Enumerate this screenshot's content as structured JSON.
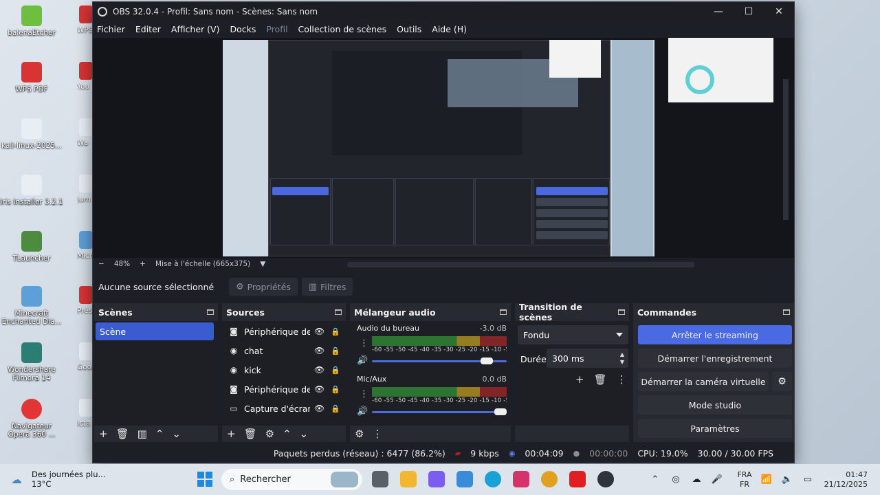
{
  "desktop": {
    "icons": [
      {
        "label": "balenaEtcher",
        "color": "#6fbf3f"
      },
      {
        "label": "WPS PDF",
        "color": "#d93333"
      },
      {
        "label": "kali-linux-2025...",
        "color": "#e8eef3"
      },
      {
        "label": "Iris Installer 3.2.1",
        "color": "#e8eef3"
      },
      {
        "label": "TLauncher",
        "color": "#4d8b3e"
      },
      {
        "label": "Minecraft Enchanted Dia...",
        "color": "#5da0d8"
      },
      {
        "label": "Wondershare Filmora 14",
        "color": "#2a7e73"
      },
      {
        "label": "Navigateur Opera 360 ...",
        "color": "#e23535"
      }
    ],
    "edge_icons": [
      "WPS",
      "You",
      "Wa",
      "jum",
      "Micro",
      "Prés",
      "Googl",
      "Icta"
    ]
  },
  "window": {
    "title": "OBS 32.0.4 - Profil: Sans nom - Scènes: Sans nom",
    "controls": {
      "minimize": "—",
      "maximize": "☐",
      "close": "✕"
    }
  },
  "menu": [
    "Fichier",
    "Editer",
    "Afficher (V)",
    "Docks",
    "Profil",
    "Collection de scènes",
    "Outils",
    "Aide (H)"
  ],
  "zoom": {
    "minus": "−",
    "value": "48%",
    "plus": "+",
    "scale": "Mise à l'échelle (665x375)",
    "caret": "▼"
  },
  "context": {
    "no_source": "Aucune source sélectionné",
    "properties": "Propriétés",
    "filters": "Filtres"
  },
  "scenes": {
    "title": "Scènes",
    "items": [
      "Scène"
    ]
  },
  "sources": {
    "title": "Sources",
    "items": [
      {
        "name": "Périphérique de capture",
        "icon": "camera-icon",
        "glyph": "◙"
      },
      {
        "name": "chat",
        "icon": "globe-icon",
        "glyph": "◉"
      },
      {
        "name": "kick",
        "icon": "globe-icon",
        "glyph": "◉"
      },
      {
        "name": "Périphérique de capture",
        "icon": "camera-icon",
        "glyph": "◙"
      },
      {
        "name": "Capture d'écran",
        "icon": "monitor-icon",
        "glyph": "▭"
      }
    ]
  },
  "mixer": {
    "title": "Mélangeur audio",
    "channels": [
      {
        "name": "Audio du bureau",
        "db": "-3.0 dB",
        "level": 0.9
      },
      {
        "name": "Mic/Aux",
        "db": "0.0 dB",
        "level": 1.0
      }
    ],
    "scale": "-60 -55 -50 -45 -40 -35 -30 -25 -20 -15 -10 -5 0"
  },
  "transition": {
    "title": "Transition de scènes",
    "type": "Fondu",
    "duration_label": "Durée",
    "duration": "300 ms"
  },
  "commands": {
    "title": "Commandes",
    "stop_stream": "Arrêter le streaming",
    "start_record": "Démarrer l'enregistrement",
    "virtual_cam": "Démarrer la caméra virtuelle",
    "studio": "Mode studio",
    "settings": "Paramètres"
  },
  "status": {
    "dropped": "Paquets perdus (réseau) : 6477 (86.2%)",
    "bitrate": "9 kbps",
    "stream_time": "00:04:09",
    "record_time": "00:00:00",
    "cpu": "CPU: 19.0%",
    "fps": "30.00 / 30.00 FPS"
  },
  "taskbar": {
    "weather_title": "Des journées plu...",
    "weather_temp": "13°C",
    "search": "Rechercher",
    "lang_top": "FRA",
    "lang_bottom": "FR",
    "time": "01:47",
    "date": "21/12/2025"
  },
  "colors": {
    "accent": "#4a6ae4",
    "panel": "#272a31",
    "bg": "#1d1f26"
  }
}
